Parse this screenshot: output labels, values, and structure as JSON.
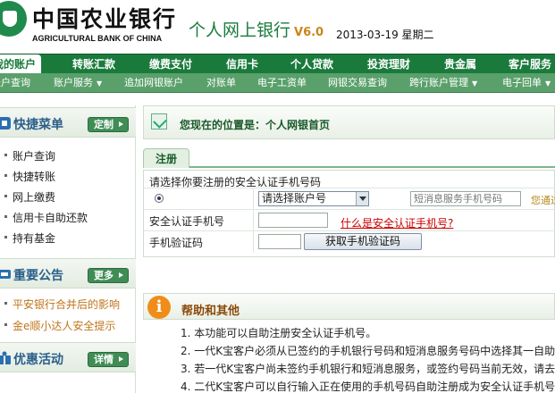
{
  "header": {
    "bank_name_cn": "中国农业银行",
    "bank_name_en": "AGRICULTURAL BANK OF CHINA",
    "site_title": "个人网上银行",
    "version": "V6.0",
    "date": "2013-03-19 星期二"
  },
  "nav": {
    "tabs": [
      {
        "label": "我的账户",
        "active": true
      },
      {
        "label": "转账汇款"
      },
      {
        "label": "缴费支付"
      },
      {
        "label": "信用卡"
      },
      {
        "label": "个人贷款"
      },
      {
        "label": "投资理财"
      },
      {
        "label": "贵金属"
      },
      {
        "label": "客户服务"
      }
    ]
  },
  "subnav": {
    "items": [
      {
        "label": "账户查询"
      },
      {
        "label": "账户服务",
        "dropdown": true
      },
      {
        "label": "追加网银账户"
      },
      {
        "label": "对账单"
      },
      {
        "label": "电子工资单"
      },
      {
        "label": "网银交易查询"
      },
      {
        "label": "跨行账户管理",
        "dropdown": true
      },
      {
        "label": "电子回单",
        "dropdown": true
      }
    ]
  },
  "sidebar": {
    "quick_menu": {
      "title": "快捷菜单",
      "button": "定制",
      "items": [
        "账户查询",
        "快捷转账",
        "网上缴费",
        "信用卡自助还款",
        "持有基金"
      ]
    },
    "notice": {
      "title": "重要公告",
      "button": "更多",
      "items": [
        "平安银行合并后的影响",
        "金e顺小达人安全提示"
      ]
    },
    "promo": {
      "title": "优惠活动",
      "button": "详情"
    }
  },
  "main": {
    "location": "您现在的位置是：个人网银首页",
    "tab": "注册",
    "form": {
      "instruction": "请选择你要注册的安全认证手机号码",
      "account_select": "请选择账户号",
      "sms_phone_placeholder": "短消息服务手机号码",
      "sms_hint": "您通过",
      "phone_label": "安全认证手机号",
      "what_is_link": "什么是安全认证手机号?",
      "code_label": "手机验证码",
      "get_code_button": "获取手机验证码"
    },
    "help": {
      "title": "帮助和其他",
      "items": [
        "1. 本功能可以自助注册安全认证手机号。",
        "2. 一代K宝客户必须从已签约的手机银行号码和短消息服务号码中选择其一自助",
        "3. 若一代K宝客户尚未签约手机银行和短消息服务，或签约号码当前无效，请去",
        "4. 二代K宝客户可以自行输入正在使用的手机号码自助注册成为安全认证手机号"
      ]
    }
  },
  "colors": {
    "brand_green": "#1a7a3c",
    "subnav_green": "#5aa06b",
    "link_red": "#cc0000",
    "help_orange": "#f08c1a"
  }
}
